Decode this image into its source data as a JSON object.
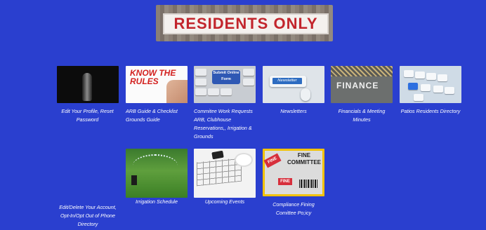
{
  "banner": {
    "text": "RESIDENTS ONLY"
  },
  "tiles": [
    {
      "caption": "Edit Your Profile, Reset Password"
    },
    {
      "caption": "ARB Guide & Checklist Grounds Guide",
      "image_text": "KNOW THE RULES"
    },
    {
      "caption": "Commitee Work Requests ARB, Clubhouse Reservations,, Irrigation & Grounds",
      "image_text": "Submit Online Form"
    },
    {
      "caption": "Newsletters",
      "image_text": "Newsletter"
    },
    {
      "caption": "Financials & Meeting Minutes",
      "image_text": "FINANCE"
    },
    {
      "caption": "Patios Residents Directory"
    },
    {
      "caption": "Irrigation Schedule"
    },
    {
      "caption": "Upcoming Events"
    },
    {
      "caption": "Compliance Fining Comittee Po;icy",
      "image_text_1": "FINE COMMITTEE",
      "image_text_2": "FINE",
      "image_text_3": "FINE"
    }
  ],
  "left_link": {
    "caption": "Edit/Delete Your Account, Opt-In/Opt Out of Phone Directory"
  }
}
